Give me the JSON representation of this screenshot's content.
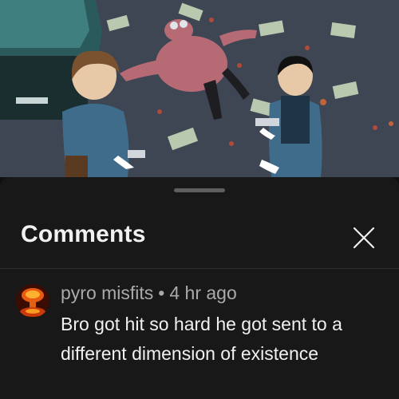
{
  "comments_panel": {
    "title": "Comments",
    "close_icon": "close-icon",
    "comments": [
      {
        "author": "pyro misfits",
        "separator": "•",
        "time": "4 hr ago",
        "text": "Bro got hit so hard he got sent to a different dimension of existence",
        "avatar_icon": "explosion-avatar"
      }
    ]
  },
  "colors": {
    "sheet_background": "#181818",
    "primary_text": "#f1f1f1",
    "secondary_text": "#aaaaaa"
  }
}
